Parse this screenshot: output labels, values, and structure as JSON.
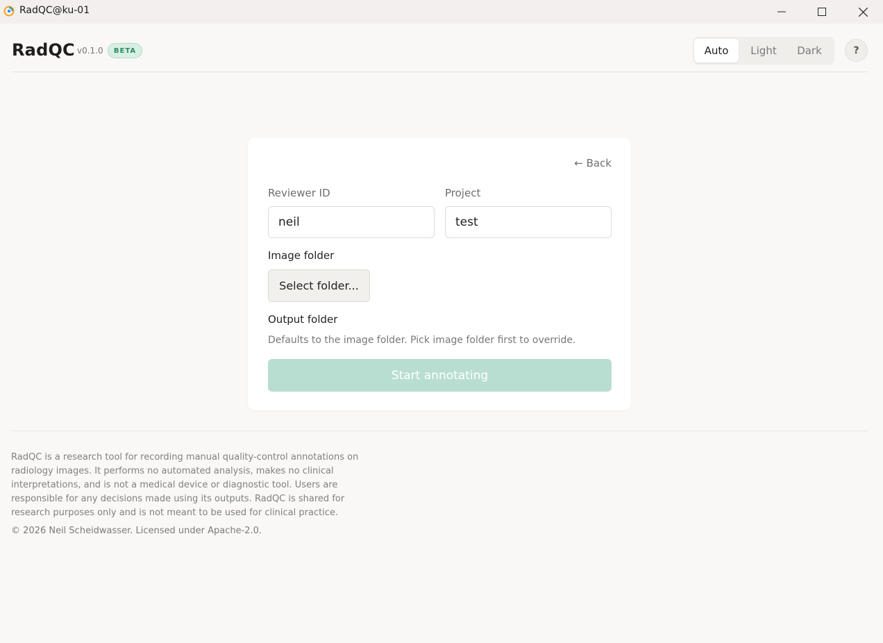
{
  "window": {
    "title": "RadQC@ku-01",
    "controls": {
      "minimize": "minimize-icon",
      "maximize": "maximize-icon",
      "close": "close-icon"
    }
  },
  "header": {
    "brand": "RadQC",
    "version": "v0.1.0",
    "badge": "BETA",
    "theme": {
      "options": [
        "Auto",
        "Light",
        "Dark"
      ],
      "selected": "Auto"
    },
    "help": "?"
  },
  "form": {
    "back": "← Back",
    "reviewer_label": "Reviewer ID",
    "reviewer_value": "neil",
    "project_label": "Project",
    "project_value": "test",
    "image_folder_label": "Image folder",
    "select_folder": "Select folder...",
    "output_folder_label": "Output folder",
    "output_hint": "Defaults to the image folder. Pick image folder first to override.",
    "start": "Start annotating"
  },
  "footer": {
    "disclaimer": "RadQC is a research tool for recording manual quality-control annotations on radiology images. It performs no automated analysis, makes no clinical interpretations, and is not a medical device or diagnostic tool. Users are responsible for any decisions made using its outputs. RadQC is shared for research purposes only and is not meant to be used for clinical practice.",
    "copyright": "© 2026 Neil Scheidwasser. Licensed under Apache-2.0."
  },
  "colors": {
    "accent": "#b8ded2",
    "badge_bg": "#d8efe4",
    "badge_text": "#2c8a61",
    "background": "#f9f8f6"
  }
}
